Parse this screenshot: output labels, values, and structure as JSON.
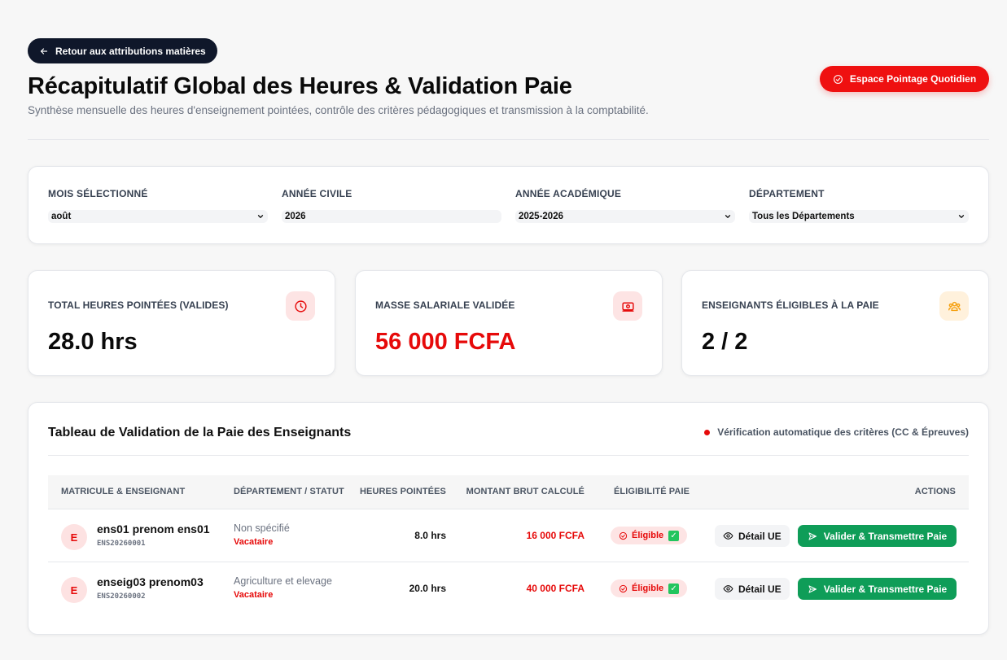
{
  "header": {
    "back_label": "Retour aux attributions matières",
    "title": "Récapitulatif Global des Heures & Validation Paie",
    "subtitle": "Synthèse mensuelle des heures d'enseignement pointées, contrôle des critères pédagogiques et transmission à la comptabilité.",
    "pointage_label": "Espace Pointage Quotidien"
  },
  "filters": [
    {
      "label": "MOIS SÉLECTIONNÉ",
      "value": "août",
      "type": "select"
    },
    {
      "label": "ANNÉE CIVILE",
      "value": "2026",
      "type": "input"
    },
    {
      "label": "ANNÉE ACADÉMIQUE",
      "value": "2025-2026",
      "type": "select"
    },
    {
      "label": "DÉPARTEMENT",
      "value": "Tous les Départements",
      "type": "select"
    }
  ],
  "stats": [
    {
      "label": "TOTAL HEURES POINTÉES (VALIDES)",
      "value": "28.0 hrs",
      "icon": "clock-icon"
    },
    {
      "label": "MASSE SALARIALE VALIDÉE",
      "value": "56 000 FCFA",
      "icon": "money-icon"
    },
    {
      "label": "ENSEIGNANTS ÉLIGIBLES À LA PAIE",
      "value": "2 / 2",
      "icon": "users-icon"
    }
  ],
  "table": {
    "title": "Tableau de Validation de la Paie des Enseignants",
    "auto_check": "Vérification automatique des critères (CC & Épreuves)",
    "columns": [
      "MATRICULE & ENSEIGNANT",
      "DÉPARTEMENT / STATUT",
      "HEURES POINTÉES",
      "MONTANT BRUT CALCULÉ",
      "ÉLIGIBILITÉ PAIE",
      "ACTIONS"
    ],
    "rows": [
      {
        "initial": "E",
        "name": "ens01 prenom ens01",
        "matricule": "ENS20260001",
        "department": "Non spécifié",
        "status": "Vacataire",
        "hours": "8.0 hrs",
        "amount": "16 000 FCFA",
        "eligibility": "Éligible",
        "detail_label": "Détail UE",
        "validate_label": "Valider & Transmettre Paie"
      },
      {
        "initial": "E",
        "name": "enseig03 prenom03",
        "matricule": "ENS20260002",
        "department": "Agriculture et elevage",
        "status": "Vacataire",
        "hours": "20.0 hrs",
        "amount": "40 000 FCFA",
        "eligibility": "Éligible",
        "detail_label": "Détail UE",
        "validate_label": "Valider & Transmettre Paie"
      }
    ]
  },
  "colors": {
    "accent_red": "#e60a0a",
    "dark_navy": "#0f172a",
    "green": "#0f9d58"
  }
}
